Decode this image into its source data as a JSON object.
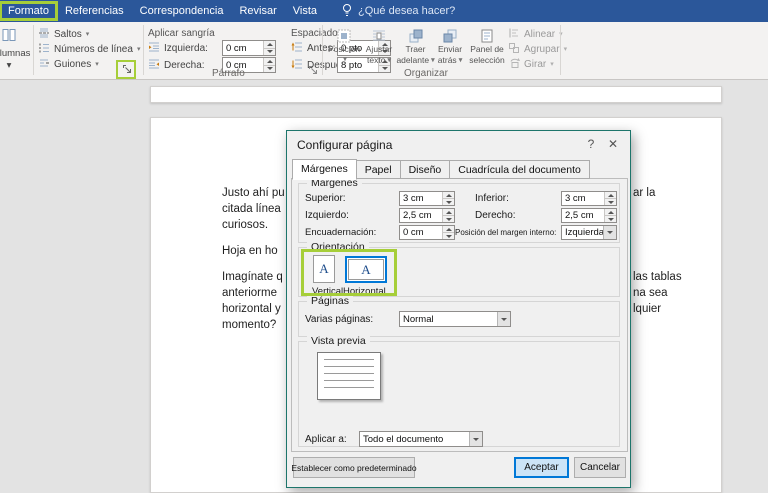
{
  "colors": {
    "highlight_green": "#a6ce39",
    "titlebar_blue": "#2b579a",
    "dialog_border_teal": "#1d756b",
    "accent_blue": "#0078d7"
  },
  "icons": {
    "caret": "▾"
  },
  "titlebar": {
    "tabs": [
      "Formato",
      "Referencias",
      "Correspondencia",
      "Revisar",
      "Vista"
    ],
    "tellme": "¿Qué desea hacer?"
  },
  "ribbon": {
    "columns_label": "Columnas",
    "breaks_label": "Saltos",
    "line_numbers_label": "Números de línea",
    "hyphenation_label": "Guiones",
    "indent_title": "Aplicar sangría",
    "indent_left_label": "Izquierda:",
    "indent_left_value": "0 cm",
    "indent_right_label": "Derecha:",
    "indent_right_value": "0 cm",
    "spacing_title": "Espaciado",
    "spacing_before_label": "Antes:",
    "spacing_before_value": "0 pto",
    "spacing_after_label": "Después:",
    "spacing_after_value": "8 pto",
    "paragraph_group_label": "Párrafo",
    "arrange_group_label": "Organizar",
    "arrange_buttons": [
      {
        "line1": "Posición",
        "line2": ""
      },
      {
        "line1": "Ajustar",
        "line2": "texto"
      },
      {
        "line1": "Traer",
        "line2": "adelante"
      },
      {
        "line1": "Enviar",
        "line2": "atrás"
      },
      {
        "line1": "Panel de",
        "line2": "selección"
      }
    ],
    "align_label": "Alinear",
    "group_label": "Agrupar",
    "rotate_label": "Girar"
  },
  "document": {
    "lines": [
      {
        "left": "Justo ahí pu",
        "right": "ar la"
      },
      {
        "left": "citada línea",
        "right": ""
      },
      {
        "left": "curiosos.",
        "right": ""
      },
      {
        "left": "Hoja en ho",
        "right": ""
      },
      {
        "left": "Imagínate q",
        "right": "las tablas"
      },
      {
        "left": "anteriorme",
        "right": "na sea"
      },
      {
        "left": "horizontal y",
        "right": "lquier"
      },
      {
        "left": "momento?",
        "right": ""
      }
    ]
  },
  "dialog": {
    "title": "Configurar página",
    "help_label": "?",
    "close_label": "✕",
    "tabs": [
      "Márgenes",
      "Papel",
      "Diseño",
      "Cuadrícula del documento"
    ],
    "margins": {
      "section_label": "Márgenes",
      "top_label": "Superior:",
      "top_value": "3 cm",
      "bottom_label": "Inferior:",
      "bottom_value": "3 cm",
      "left_label": "Izquierdo:",
      "left_value": "2,5 cm",
      "right_label": "Derecho:",
      "right_value": "2,5 cm",
      "gutter_label": "Encuadernación:",
      "gutter_value": "0 cm",
      "gutter_position_label": "Posición del margen interno:",
      "gutter_position_value": "Izquierda"
    },
    "orientation": {
      "section_label": "Orientación",
      "portrait_label": "Vertical",
      "landscape_label": "Horizontal",
      "tile_letter": "A"
    },
    "pages": {
      "section_label": "Páginas",
      "multiple_label": "Varias páginas:",
      "multiple_value": "Normal"
    },
    "preview": {
      "section_label": "Vista previa",
      "apply_label": "Aplicar a:",
      "apply_value": "Todo el documento"
    },
    "buttons": {
      "default": "Establecer como predeterminado",
      "ok": "Aceptar",
      "cancel": "Cancelar"
    }
  }
}
